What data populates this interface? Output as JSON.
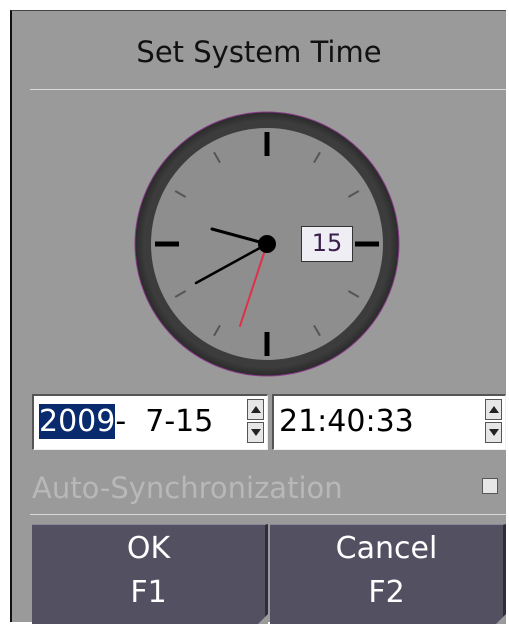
{
  "dialog": {
    "title": "Set System Time"
  },
  "clock": {
    "date_badge": "15"
  },
  "date_field": {
    "year": "2009",
    "rest": "-  7-15"
  },
  "time_field": {
    "value": "21:40:33"
  },
  "auto_sync": {
    "label": "Auto-Synchronization",
    "checked": false
  },
  "buttons": {
    "ok_label": "OK",
    "ok_key": "F1",
    "cancel_label": "Cancel",
    "cancel_key": "F2"
  },
  "colors": {
    "dialog_bg": "#9a9a9a",
    "button_bg": "#535062",
    "selection_bg": "#0a2a6e",
    "second_hand": "#e0304a"
  }
}
